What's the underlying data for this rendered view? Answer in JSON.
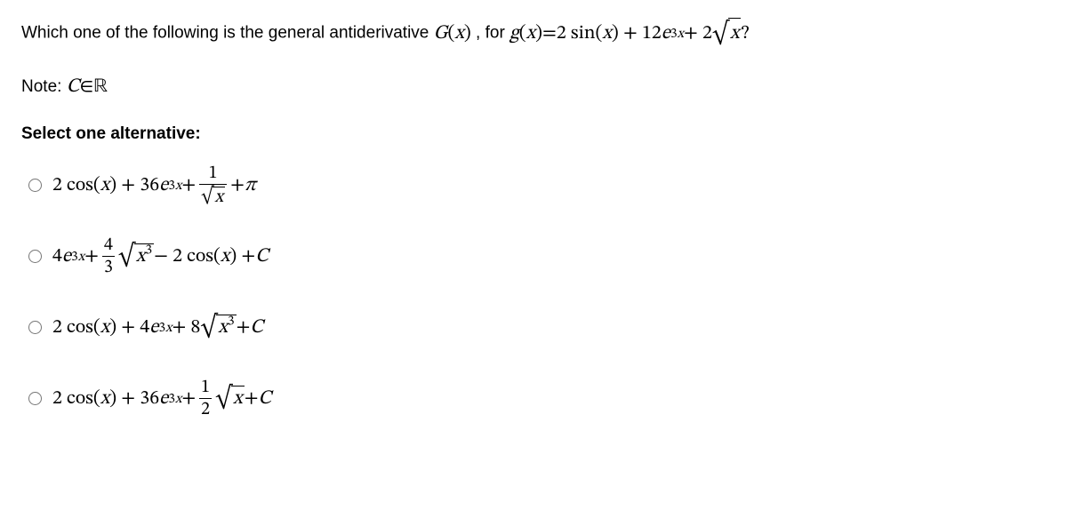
{
  "question": {
    "prefix": "Which one of the following is the general antiderivative ",
    "G": "G",
    "paren_x1": "(x)",
    "for": ", for ",
    "g": "g",
    "paren_x2": "(x)",
    "eq": " = ",
    "rhs_a": "2 sin(",
    "rhs_x": "x",
    "rhs_b": ") + 12",
    "rhs_e": "e",
    "rhs_exp_3": "3",
    "rhs_exp_x": "x",
    "rhs_c": " + 2",
    "sqrt_x": "x",
    "rhs_d": " ?"
  },
  "note": {
    "label": "Note: ",
    "C": "C",
    "in": " ∈ ",
    "R": "ℝ"
  },
  "select_line": "Select one alternative:",
  "options": {
    "a": {
      "p1": "2 cos(",
      "x1": "x",
      "p2": ") + 36",
      "e": "e",
      "exp3": "3",
      "expx": "x",
      "p3": " + ",
      "num": "1",
      "den_x": "x",
      "p4": " + ",
      "pi": "π"
    },
    "b": {
      "p1": "4",
      "e": "e",
      "exp3": "3",
      "expx": "x",
      "p2": " + ",
      "num": "4",
      "den": "3",
      "sqrt_x": "x",
      "sqrt_exp": "3",
      "p3": " − 2 cos(",
      "x2": "x",
      "p4": ") + ",
      "C": "C"
    },
    "c": {
      "p1": "2 cos(",
      "x1": "x",
      "p2": ") + 4",
      "e": "e",
      "exp3": "3",
      "expx": "x",
      "p3": " + 8",
      "sqrt_x": "x",
      "sqrt_exp": "3",
      "p4": " + ",
      "C": "C"
    },
    "d": {
      "p1": "2 cos(",
      "x1": "x",
      "p2": ") + 36",
      "e": "e",
      "exp3": "3",
      "expx": "x",
      "p3": " + ",
      "num": "1",
      "den": "2",
      "sqrt_x": "x",
      "p4": " + ",
      "C": "C"
    }
  }
}
